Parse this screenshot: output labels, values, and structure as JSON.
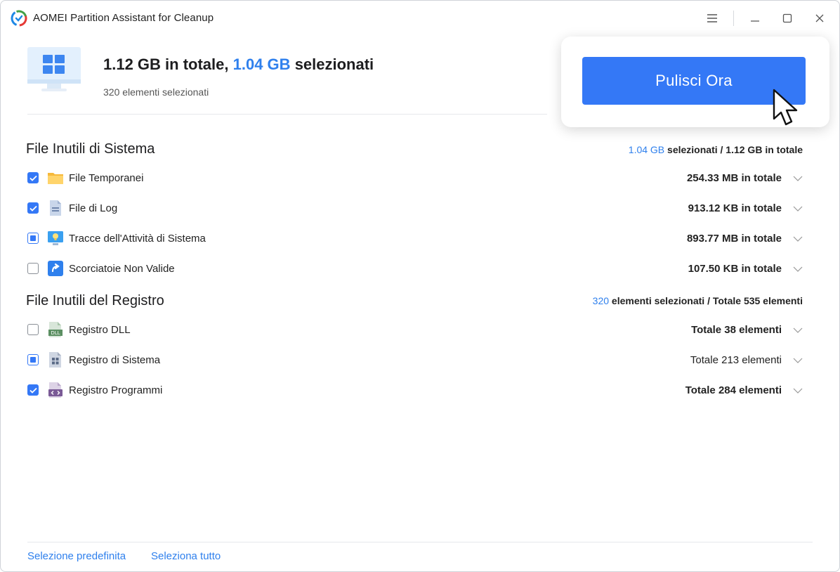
{
  "window": {
    "title": "AOMEI Partition Assistant for Cleanup"
  },
  "summary": {
    "total": "1.12 GB in totale,",
    "selected_value": "1.04 GB",
    "selected_suffix": "selezionati",
    "items_selected": "320 elementi selezionati"
  },
  "clean_button": {
    "label": "Pulisci Ora"
  },
  "system_section": {
    "title": "File Inutili di Sistema",
    "selected": "1.04 GB",
    "selected_text": "selezionati / 1.12 GB in totale",
    "items": [
      {
        "label": "File Temporanei",
        "size": "254.33 MB in totale",
        "state": "checked",
        "icon": "folder-icon"
      },
      {
        "label": "File di Log",
        "size": "913.12 KB in totale",
        "state": "checked",
        "icon": "log-file-icon"
      },
      {
        "label": "Tracce dell'Attività di Sistema",
        "size": "893.77 MB in totale",
        "state": "partial",
        "icon": "activity-trace-icon"
      },
      {
        "label": "Scorciatoie Non Valide",
        "size": "107.50 KB in totale",
        "state": "unchecked",
        "icon": "shortcut-icon"
      }
    ]
  },
  "registry_section": {
    "title": "File Inutili del Registro",
    "selected": "320",
    "selected_text": "elementi selezionati / Totale 535 elementi",
    "items": [
      {
        "label": "Registro DLL",
        "size": "Totale 38 elementi",
        "state": "unchecked",
        "icon": "dll-icon"
      },
      {
        "label": "Registro di Sistema",
        "size": "Totale 213 elementi",
        "state": "partial",
        "icon": "system-registry-icon"
      },
      {
        "label": "Registro Programmi",
        "size": "Totale 284 elementi",
        "state": "checked",
        "icon": "program-registry-icon"
      }
    ]
  },
  "footer": {
    "default_selection": "Selezione predefinita",
    "select_all": "Seleziona tutto"
  },
  "colors": {
    "accent": "#3478f6",
    "link": "#2f80ed"
  }
}
